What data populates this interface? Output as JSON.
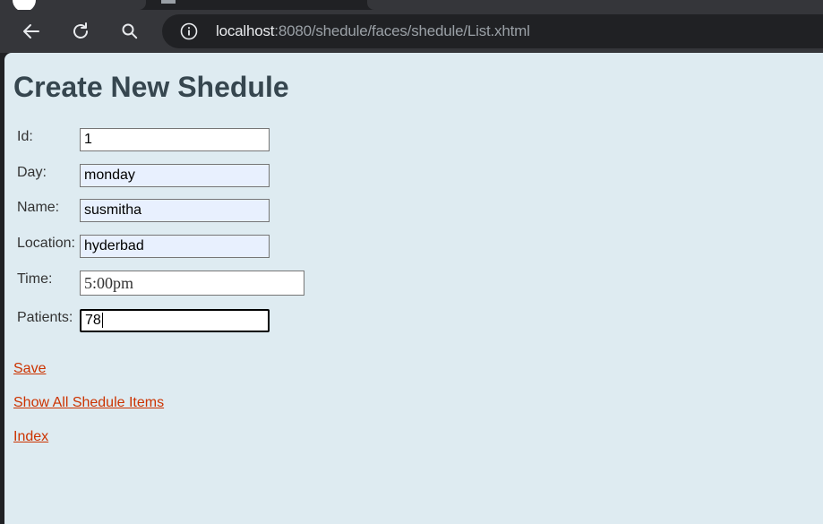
{
  "browser": {
    "url_host": "localhost",
    "url_rest": ":8080/shedule/faces/shedule/List.xhtml"
  },
  "page": {
    "title": "Create New Shedule",
    "form": {
      "id_label": "Id:",
      "id_value": "1",
      "day_label": "Day:",
      "day_value": "monday",
      "name_label": "Name:",
      "name_value": "susmitha",
      "location_label": "Location:",
      "location_value": "hyderbad",
      "time_label": "Time:",
      "time_value": "5:00pm",
      "patients_label": "Patients:",
      "patients_value": "78"
    },
    "links": {
      "save": "Save",
      "show_all": "Show All Shedule Items",
      "index": "Index"
    }
  },
  "colors": {
    "page_background": "#deebf1",
    "link": "#cc3300",
    "heading": "#36464f",
    "autofill_background": "#e8f0fe"
  }
}
